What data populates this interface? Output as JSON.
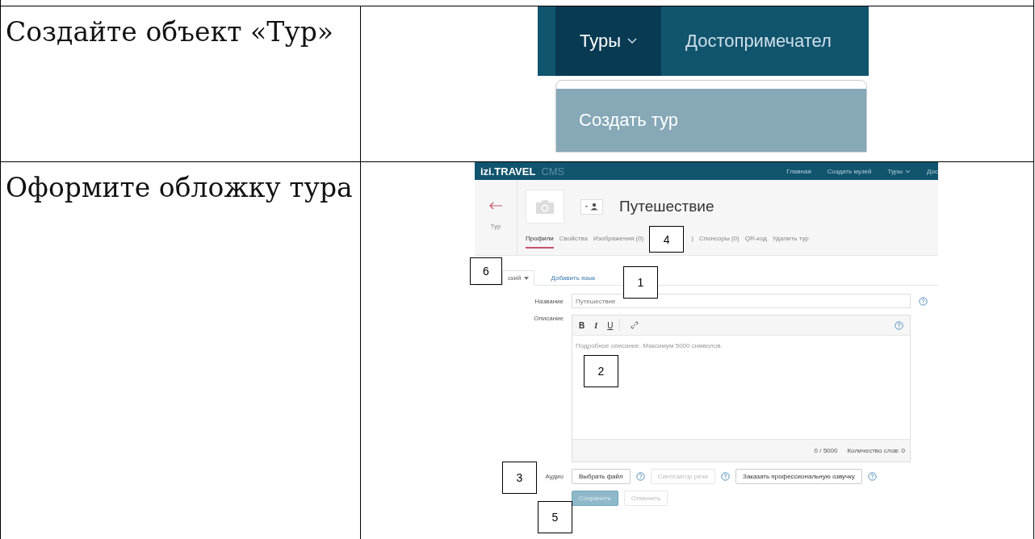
{
  "rows": [
    {
      "instruction": "Создайте объект «Тур»",
      "screenshot": {
        "kind": "menu",
        "nav": [
          {
            "label": "Туры",
            "selected": true,
            "caret": true
          },
          {
            "label": "Достопримечател",
            "selected": false,
            "caret": false
          }
        ],
        "menu_items": [
          {
            "label": "Создать тур",
            "selected": true
          }
        ]
      }
    },
    {
      "instruction": "Оформите обложку тура",
      "screenshot": {
        "kind": "form",
        "brand": "izi.TRAVEL",
        "brand_suffix": "CMS",
        "nav": [
          {
            "label": "Главная",
            "caret": false
          },
          {
            "label": "Создать музей",
            "caret": false
          },
          {
            "label": "Туры",
            "caret": true
          },
          {
            "label": "Дос",
            "caret": false
          }
        ],
        "back_label": "Тур",
        "title": "Путешествие",
        "tabs": [
          {
            "label": "Профили",
            "selected": true
          },
          {
            "label": "Свойства",
            "selected": false
          },
          {
            "label": "Изображения (0)",
            "selected": false
          },
          {
            "label": ")",
            "selected": false
          },
          {
            "label": "Спонсоры (0)",
            "selected": false
          },
          {
            "label": "QR-код",
            "selected": false
          },
          {
            "label": "Удалить тур",
            "selected": false
          }
        ],
        "language_tabs": [
          {
            "label": "ский",
            "selected": true,
            "caret": true
          },
          {
            "label": "Добавить язык",
            "selected": false,
            "caret": false
          }
        ],
        "name_label": "Название",
        "name_value": "Путешествие",
        "description_label": "Описание",
        "toolbar": [
          "B",
          "I",
          "U"
        ],
        "description_placeholder": "Подробное описание. Максимум 5000 символов.",
        "char_count": "0 / 5000",
        "word_count": "Количество слов: 0",
        "audio_label": "Аудио",
        "audio_buttons": [
          {
            "label": "Выбрать файл",
            "disabled": false
          },
          {
            "label": "Синтезатор речи",
            "disabled": true
          },
          {
            "label": "Заказать профессиональную озвучку",
            "disabled": false
          }
        ],
        "actions": [
          {
            "label": "Сохранить",
            "kind": "primary",
            "disabled": true
          },
          {
            "label": "Отменить",
            "kind": "default",
            "disabled": true
          }
        ],
        "callouts": {
          "tabs": "4",
          "language": "6",
          "name": "1",
          "editor": "2",
          "audio": "3",
          "actions": "5"
        }
      }
    }
  ]
}
